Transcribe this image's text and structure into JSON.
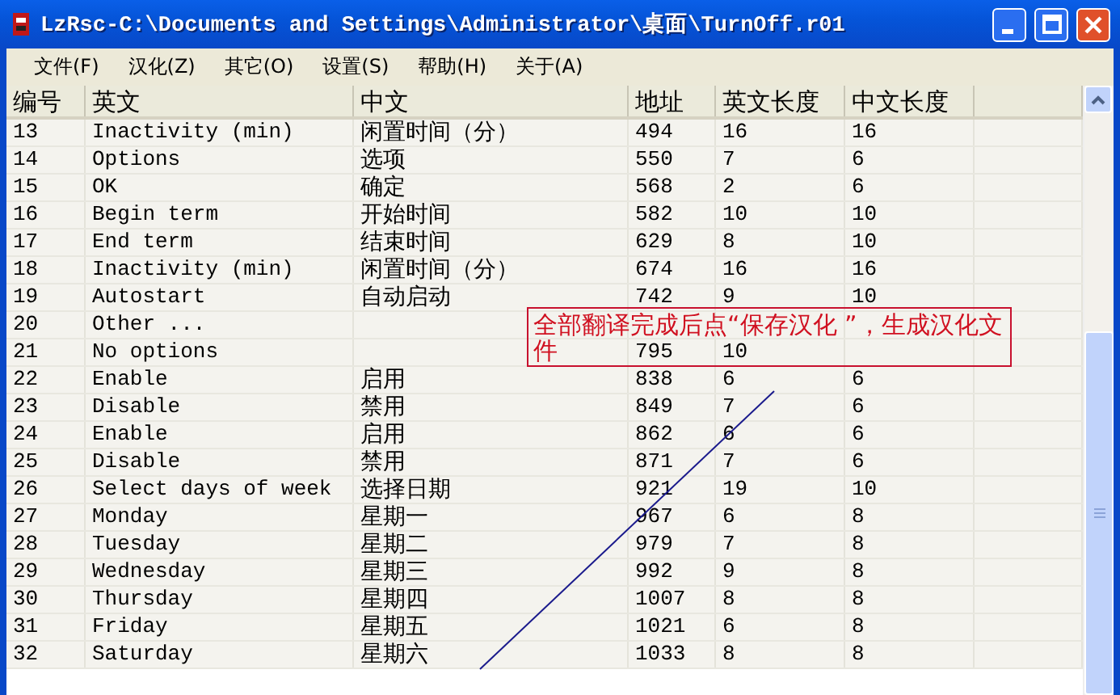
{
  "window": {
    "title": "LzRsc-C:\\Documents and Settings\\Administrator\\桌面\\TurnOff.r01"
  },
  "menu": [
    "文件(F)",
    "汉化(Z)",
    "其它(O)",
    "设置(S)",
    "帮助(H)",
    "关于(A)"
  ],
  "table": {
    "columns": [
      "编号",
      "英文",
      "中文",
      "地址",
      "英文长度",
      "中文长度"
    ],
    "rows": [
      {
        "no": "13",
        "en": "Inactivity (min)",
        "zh": "闲置时间（分）",
        "addr": "494",
        "en_len": "16",
        "zh_len": "16"
      },
      {
        "no": "14",
        "en": "Options",
        "zh": "选项",
        "addr": "550",
        "en_len": "7",
        "zh_len": "6"
      },
      {
        "no": "15",
        "en": "OK",
        "zh": "确定",
        "addr": "568",
        "en_len": "2",
        "zh_len": "6"
      },
      {
        "no": "16",
        "en": "Begin term",
        "zh": "开始时间",
        "addr": "582",
        "en_len": "10",
        "zh_len": "10"
      },
      {
        "no": "17",
        "en": "End term",
        "zh": "结束时间",
        "addr": "629",
        "en_len": "8",
        "zh_len": "10"
      },
      {
        "no": "18",
        "en": "Inactivity (min)",
        "zh": "闲置时间（分）",
        "addr": "674",
        "en_len": "16",
        "zh_len": "16"
      },
      {
        "no": "19",
        "en": "Autostart",
        "zh": "自动启动",
        "addr": "742",
        "en_len": "9",
        "zh_len": "10"
      },
      {
        "no": "20",
        "en": "Other ..."
      },
      {
        "no": "21",
        "en": "No options",
        "addr": "795",
        "en_len": "10"
      },
      {
        "no": "22",
        "en": "Enable",
        "zh": "启用",
        "addr": "838",
        "en_len": "6",
        "zh_len": "6"
      },
      {
        "no": "23",
        "en": "Disable",
        "zh": "禁用",
        "addr": "849",
        "en_len": "7",
        "zh_len": "6"
      },
      {
        "no": "24",
        "en": "Enable",
        "zh": "启用",
        "addr": "862",
        "en_len": "6",
        "zh_len": "6"
      },
      {
        "no": "25",
        "en": "Disable",
        "zh": "禁用",
        "addr": "871",
        "en_len": "7",
        "zh_len": "6"
      },
      {
        "no": "26",
        "en": "Select days of week",
        "zh": "选择日期",
        "addr": "921",
        "en_len": "19",
        "zh_len": "10"
      },
      {
        "no": "27",
        "en": "Monday",
        "zh": "星期一",
        "addr": "967",
        "en_len": "6",
        "zh_len": "8"
      },
      {
        "no": "28",
        "en": "Tuesday",
        "zh": "星期二",
        "addr": "979",
        "en_len": "7",
        "zh_len": "8"
      },
      {
        "no": "29",
        "en": "Wednesday",
        "zh": "星期三",
        "addr": "992",
        "en_len": "9",
        "zh_len": "8"
      },
      {
        "no": "30",
        "en": "Thursday",
        "zh": "星期四",
        "addr": "1007",
        "en_len": "8",
        "zh_len": "8"
      },
      {
        "no": "31",
        "en": "Friday",
        "zh": "星期五",
        "addr": "1021",
        "en_len": "6",
        "zh_len": "8"
      },
      {
        "no": "32",
        "en": "Saturday",
        "zh": "星期六",
        "addr": "1033",
        "en_len": "8",
        "zh_len": "8"
      }
    ]
  },
  "callout": {
    "text": "全部翻译完成后点“保存汉化 ”，生成汉化文件"
  }
}
